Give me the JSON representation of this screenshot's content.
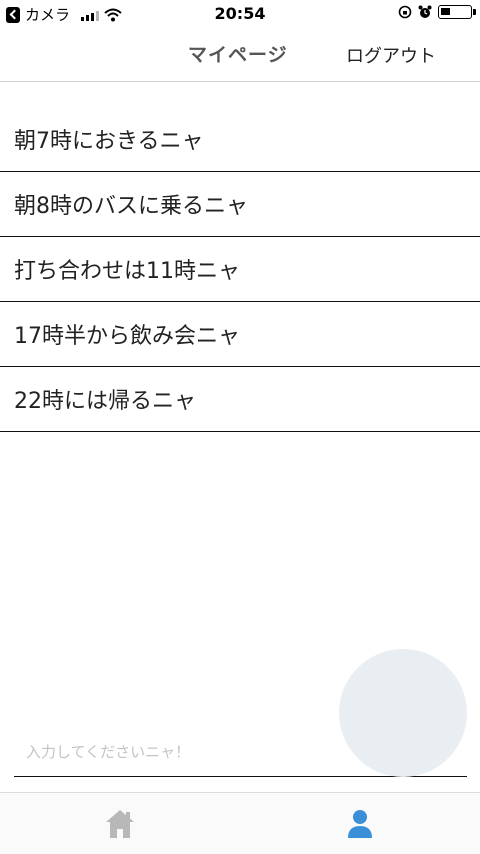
{
  "status_bar": {
    "carrier": "カメラ",
    "time": "20:54"
  },
  "header": {
    "title": "マイページ",
    "logout_label": "ログアウト"
  },
  "tasks": [
    {
      "text": "朝7時におきるニャ"
    },
    {
      "text": "朝8時のバスに乗るニャ"
    },
    {
      "text": "打ち合わせは11時ニャ"
    },
    {
      "text": "17時半から飲み会ニャ"
    },
    {
      "text": "22時には帰るニャ"
    }
  ],
  "input": {
    "placeholder": "入力してくださいニャ！",
    "value": ""
  },
  "tab_bar": {
    "items": [
      {
        "icon": "home-icon",
        "active": false
      },
      {
        "icon": "user-icon",
        "active": true
      }
    ]
  },
  "colors": {
    "active_tab": "#3b8fd6",
    "inactive_tab": "#b8b8b8",
    "fab": "#e9eef2"
  }
}
